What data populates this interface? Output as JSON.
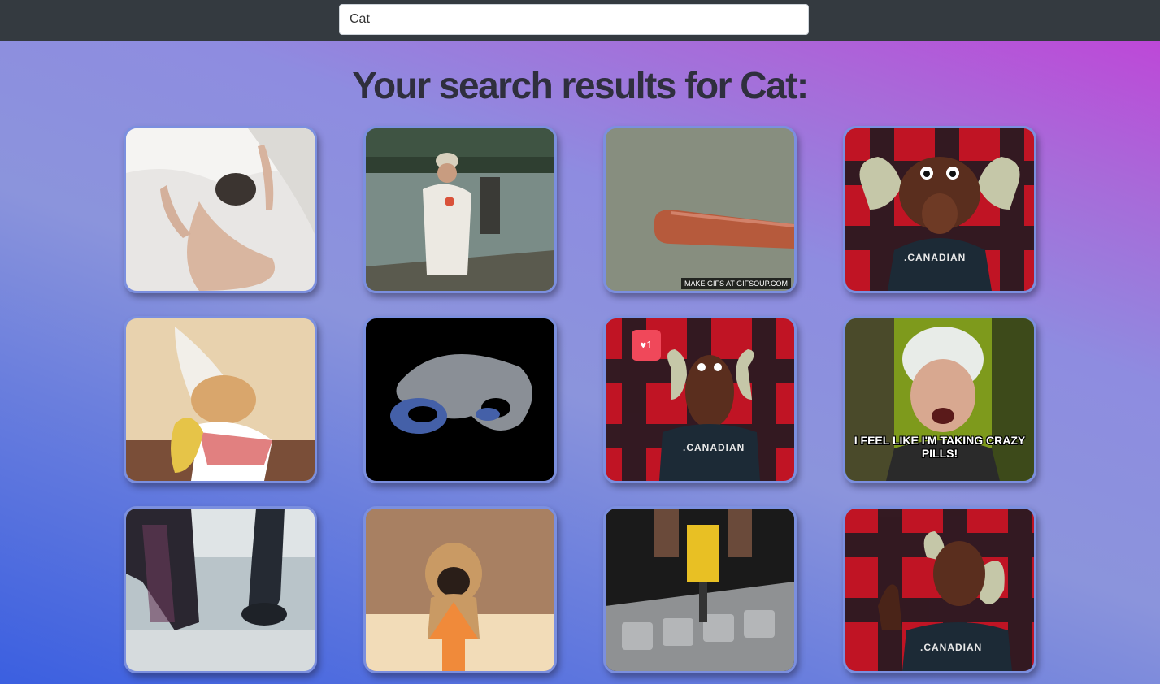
{
  "search": {
    "value": "Cat"
  },
  "heading": "Your search results for Cat:",
  "results": [
    {
      "overlay": ""
    },
    {
      "overlay": ""
    },
    {
      "overlay": "MAKE GIFS AT GIFSOUP.COM"
    },
    {
      "overlay": ".CANADIAN"
    },
    {
      "overlay": ""
    },
    {
      "overlay": ""
    },
    {
      "overlay": ".CANADIAN",
      "badge": "♥1"
    },
    {
      "overlay": "I FEEL LIKE I'M TAKING CRAZY PILLS!"
    },
    {
      "overlay": ""
    },
    {
      "overlay": ""
    },
    {
      "overlay": ""
    },
    {
      "overlay": ".CANADIAN"
    }
  ],
  "colors": {
    "navbar": "#343a40",
    "card_border": "#7b8fdf",
    "heading": "#2f2f3e"
  }
}
